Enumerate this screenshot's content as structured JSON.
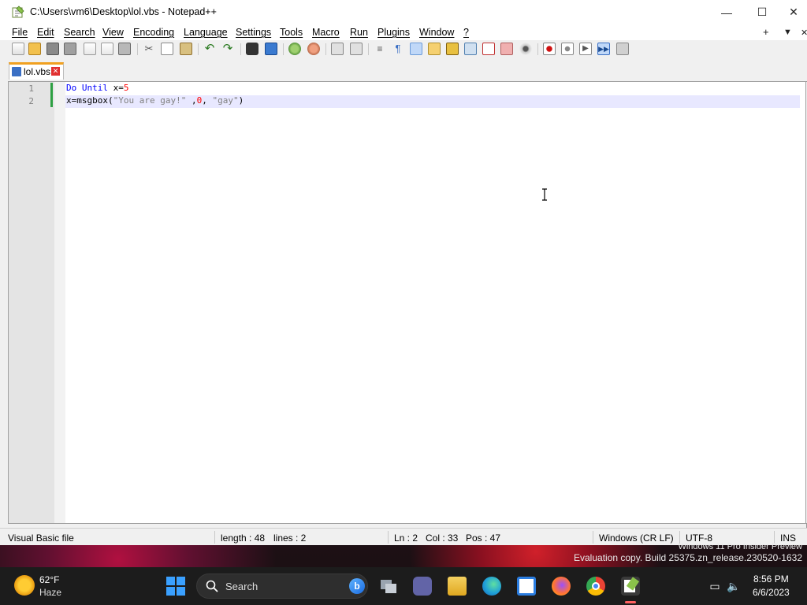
{
  "window": {
    "title": "C:\\Users\\vm6\\Desktop\\lol.vbs - Notepad++",
    "minimize_glyph": "—",
    "maximize_glyph": "☐",
    "close_glyph": "✕"
  },
  "menubar": {
    "items": [
      "File",
      "Edit",
      "Search",
      "View",
      "Encoding",
      "Language",
      "Settings",
      "Tools",
      "Macro",
      "Run",
      "Plugins",
      "Window",
      "?"
    ],
    "right": [
      "+",
      "▼",
      "✕"
    ]
  },
  "toolbar": {
    "buttons": [
      "new-file",
      "open-file",
      "save",
      "save-all",
      "close",
      "close-all",
      "print",
      "cut",
      "copy",
      "paste",
      "undo",
      "redo",
      "find",
      "replace",
      "zoom-in",
      "zoom-out",
      "sync-vertical",
      "sync-horizontal",
      "word-wrap",
      "show-all-chars",
      "indent-guide",
      "define-language",
      "doc-map",
      "function-list",
      "folder-workspace",
      "document-list",
      "monitoring",
      "record-macro",
      "stop-record",
      "playback-macro",
      "run-macro-multiple",
      "save-macro"
    ]
  },
  "tabs": [
    {
      "label": "lol.vbs",
      "close_glyph": "✕"
    }
  ],
  "editor": {
    "lines": [
      {
        "number": "1",
        "tokens": [
          {
            "t": "Do",
            "c": "kw"
          },
          {
            "t": " ",
            "c": "op"
          },
          {
            "t": "Until",
            "c": "kw"
          },
          {
            "t": " x=",
            "c": "op"
          },
          {
            "t": "5",
            "c": "num"
          }
        ]
      },
      {
        "number": "2",
        "tokens": [
          {
            "t": "x=msgbox(",
            "c": "op"
          },
          {
            "t": "\"You are gay!\"",
            "c": "str"
          },
          {
            "t": " ,",
            "c": "op"
          },
          {
            "t": "0",
            "c": "num"
          },
          {
            "t": ", ",
            "c": "op"
          },
          {
            "t": "\"gay\"",
            "c": "str"
          },
          {
            "t": ")",
            "c": "op"
          }
        ]
      }
    ],
    "current_line": 2
  },
  "statusbar": {
    "file_type": "Visual Basic file",
    "length": "length : 48",
    "lines": "lines : 2",
    "ln": "Ln : 2",
    "col": "Col : 33",
    "pos": "Pos : 47",
    "eol": "Windows (CR LF)",
    "encoding": "UTF-8",
    "mode": "INS"
  },
  "desktop": {
    "watermark_line1": "Windows 11 Pro Insider Preview",
    "watermark_line2": "Evaluation copy. Build 25375.zn_release.230520-1632"
  },
  "taskbar": {
    "weather_temp": "62°F",
    "weather_desc": "Haze",
    "search_label": "Search",
    "bing_glyph": "b",
    "time": "8:56 PM",
    "date": "6/6/2023",
    "colors": {
      "task_view": "#9aa4b0",
      "teams": "#6264a7",
      "explorer": "#f4c430",
      "edge": "#1fa0d8",
      "store": "#2b7de0",
      "firefox": "#ff7139",
      "chrome": "#34a853",
      "notepadpp": "#8ac24a"
    }
  }
}
